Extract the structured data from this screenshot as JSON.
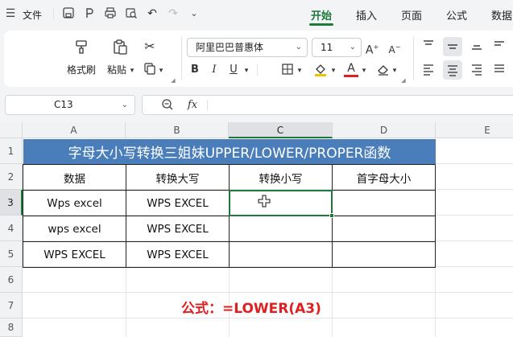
{
  "topbar": {
    "file_label": "文件",
    "tabs": [
      "开始",
      "插入",
      "页面",
      "公式",
      "数据"
    ],
    "active_tab": "开始"
  },
  "ribbon": {
    "format_painter": "格式刷",
    "paste": "粘贴",
    "font_name": "阿里巴巴普惠体",
    "font_size": "11",
    "bold": "B",
    "italic": "I",
    "underline": "U",
    "font_color_glyph": "A"
  },
  "formula_bar": {
    "name_box": "C13",
    "fx": "fx",
    "formula": ""
  },
  "sheet": {
    "columns": [
      "A",
      "B",
      "C",
      "D",
      "E"
    ],
    "rows": [
      "1",
      "2",
      "3",
      "4",
      "5",
      "6",
      "7",
      "8"
    ],
    "title": "字母大小写转换三姐妹UPPER/LOWER/PROPER函数",
    "headers": [
      "数据",
      "转换大写",
      "转换小写",
      "首字母大小"
    ],
    "data": [
      [
        "Wps excel",
        "WPS EXCEL",
        "",
        ""
      ],
      [
        "wps excel",
        "WPS EXCEL",
        "",
        ""
      ],
      [
        "WPS EXCEL",
        "WPS EXCEL",
        "",
        ""
      ]
    ],
    "formula_note": "公式：=LOWER(A3)"
  },
  "colors": {
    "accent_green": "#1f7a3a",
    "title_fill": "#4a7ebb",
    "note_red": "#e02020"
  }
}
